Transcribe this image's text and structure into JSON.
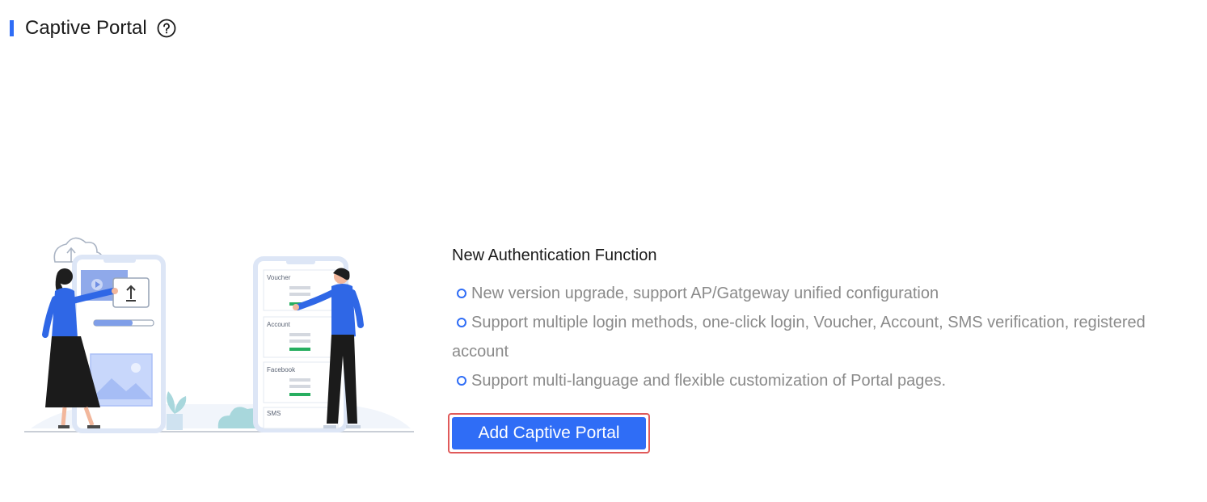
{
  "header": {
    "title": "Captive Portal",
    "help_icon": "question-circle-icon",
    "accent_color": "#2f6df6"
  },
  "illustration": {
    "phone_cards": [
      "Voucher",
      "Account",
      "Facebook",
      "SMS"
    ]
  },
  "main": {
    "title": "New Authentication Function",
    "features": [
      "New version upgrade, support AP/Gatgeway unified configuration",
      "Support multiple login methods, one-click login, Voucher, Account, SMS verification, registered account",
      "Support multi-language and flexible customization of Portal pages."
    ],
    "add_button_label": "Add Captive Portal",
    "highlight_color": "#e05a5a"
  }
}
